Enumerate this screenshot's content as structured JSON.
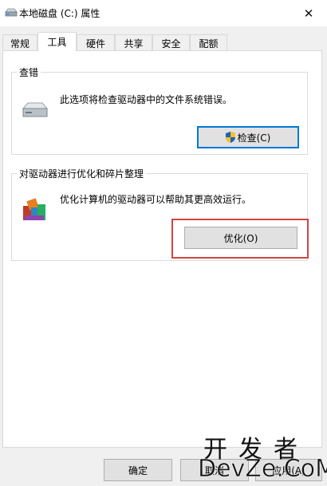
{
  "window": {
    "title": "本地磁盘 (C:) 属性",
    "close_glyph": "✕"
  },
  "tabs": [
    {
      "label": "常规",
      "active": false
    },
    {
      "label": "工具",
      "active": true
    },
    {
      "label": "硬件",
      "active": false
    },
    {
      "label": "共享",
      "active": false
    },
    {
      "label": "安全",
      "active": false
    },
    {
      "label": "配额",
      "active": false
    }
  ],
  "error_check": {
    "legend": "查错",
    "description": "此选项将检查驱动器中的文件系统错误。",
    "button_label": "检查(C)",
    "icon": "drive-icon"
  },
  "optimize": {
    "legend": "对驱动器进行优化和碎片整理",
    "description": "优化计算机的驱动器可以帮助其更高效运行。",
    "button_label": "优化(O)",
    "icon": "defrag-icon"
  },
  "footer": {
    "ok_label": "确定",
    "cancel_label": "取消",
    "apply_label": "应用(A)"
  },
  "watermark": {
    "line1": "开发者",
    "line2": "DevZe.CoM"
  },
  "colors": {
    "focus_border": "#0078d7",
    "highlight_border": "#d04545"
  }
}
